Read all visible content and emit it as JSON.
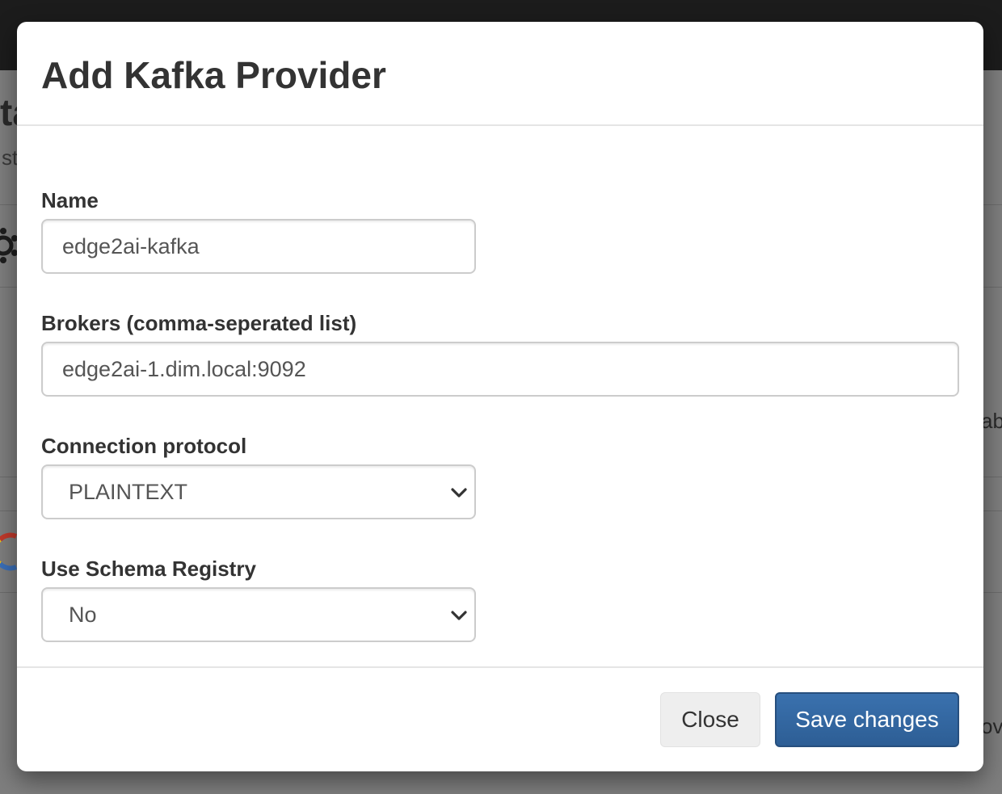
{
  "modal": {
    "title": "Add Kafka Provider",
    "fields": {
      "name": {
        "label": "Name",
        "value": "edge2ai-kafka"
      },
      "brokers": {
        "label": "Brokers (comma-seperated list)",
        "value": "edge2ai-1.dim.local:9092"
      },
      "connection_protocol": {
        "label": "Connection protocol",
        "selected": "PLAINTEXT"
      },
      "schema_registry": {
        "label": "Use Schema Registry",
        "selected": "No"
      }
    },
    "buttons": {
      "close": "Close",
      "save": "Save changes"
    }
  },
  "background": {
    "fragments": [
      "ta",
      "st",
      "ab",
      "ov"
    ]
  },
  "colors": {
    "primary": "#337ab7",
    "default_button": "#eeeeee",
    "text": "#333333",
    "backdrop": "#7e7e7e"
  }
}
